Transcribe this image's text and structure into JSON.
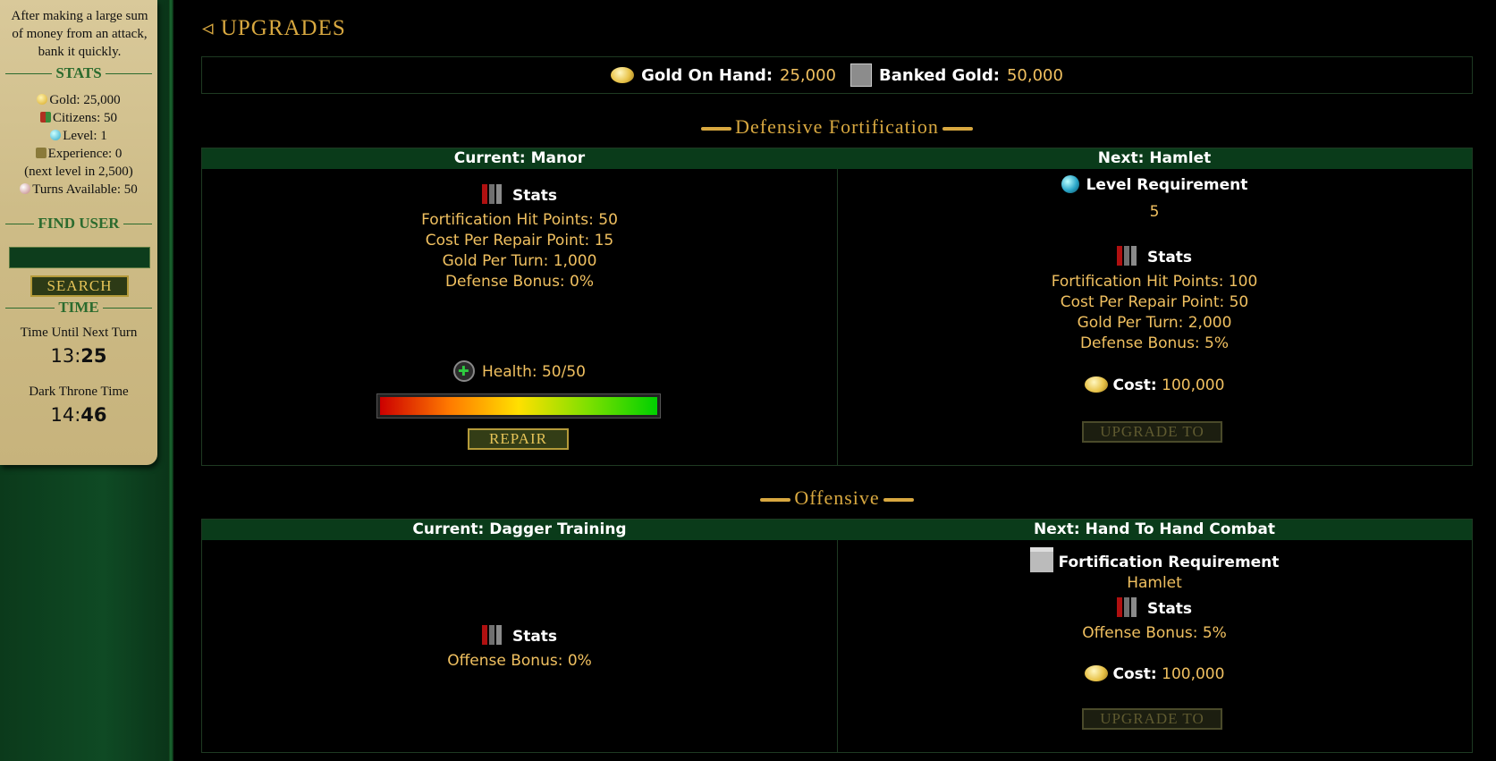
{
  "sidebar": {
    "tip": "After making a large sum of money from an attack, bank it quickly.",
    "stats_heading": "STATS",
    "stats": {
      "gold": "Gold: 25,000",
      "citizens": "Citizens: 50",
      "level": "Level: 1",
      "experience": "Experience: 0",
      "next_level": "(next level in 2,500)",
      "turns": "Turns Available: 50"
    },
    "find_user_heading": "FIND USER",
    "find_user_value": "",
    "search_label": "SEARCH",
    "time_heading": "TIME",
    "next_turn_label": "Time Until Next Turn",
    "next_turn_min": "13",
    "next_turn_sec": "25",
    "dt_time_label": "Dark Throne Time",
    "dt_time_hour": "14",
    "dt_time_min": "46"
  },
  "page_title": "UPGRADES",
  "gold_bar": {
    "gold_on_hand_label": "Gold On Hand:",
    "gold_on_hand": "25,000",
    "banked_label": "Banked Gold:",
    "banked": "50,000"
  },
  "defensive": {
    "title": "Defensive Fortification",
    "current_header": "Current: Manor",
    "next_header": "Next: Hamlet",
    "stats_label": "Stats",
    "current_stats": [
      "Fortification Hit Points: 50",
      "Cost Per Repair Point: 15",
      "Gold Per Turn: 1,000",
      "Defense Bonus: 0%"
    ],
    "health": "Health: 50/50",
    "health_fraction": 1.0,
    "repair_label": "REPAIR",
    "level_req_label": "Level Requirement",
    "level_req_value": "5",
    "next_stats": [
      "Fortification Hit Points: 100",
      "Cost Per Repair Point: 50",
      "Gold Per Turn: 2,000",
      "Defense Bonus: 5%"
    ],
    "cost_label": "Cost:",
    "cost_value": "100,000",
    "upgrade_label": "UPGRADE TO"
  },
  "offensive": {
    "title": "Offensive",
    "current_header": "Current: Dagger Training",
    "next_header": "Next: Hand To Hand Combat",
    "stats_label": "Stats",
    "current_stats": [
      "Offense Bonus: 0%"
    ],
    "fort_req_label": "Fortification Requirement",
    "fort_req_value": "Hamlet",
    "next_stats": [
      "Offense Bonus: 5%"
    ],
    "cost_label": "Cost:",
    "cost_value": "100,000",
    "upgrade_label": "UPGRADE TO"
  },
  "colors": {
    "accent_gold": "#f0c060",
    "header_green": "#0a3b1a",
    "sidebar_green": "#0f4a24"
  }
}
